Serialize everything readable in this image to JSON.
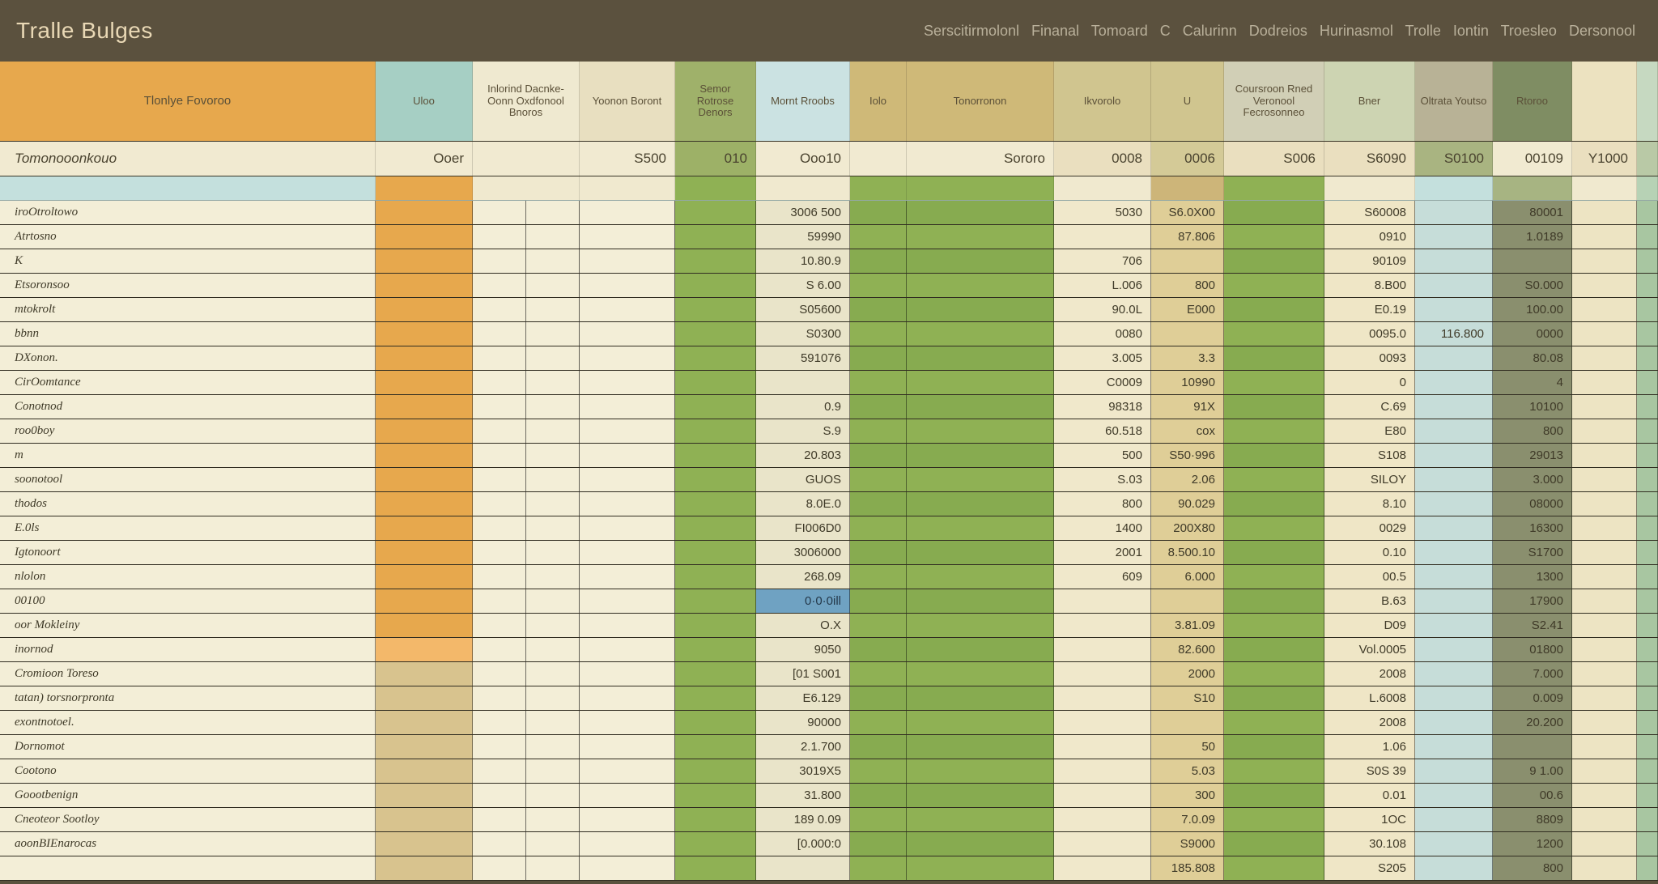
{
  "topbar": {
    "title": "Tralle Bulges",
    "subtitle": "Serscitirmolonl Finanal Tomoard C Calurinn Dodreios Hurinasmol Trolle Iontin Troesleo Dersonool"
  },
  "columns": [
    {
      "label": "Tlonlye Fovoroo"
    },
    {
      "label": "Uloo"
    },
    {
      "label": "Inlorind Dacnke-Oonn Oxdfonool Bnoros"
    },
    {
      "label": "Yoonon Boront"
    },
    {
      "label": "Semor Rotrose Denors"
    },
    {
      "label": "Mornt Rroobs"
    },
    {
      "label": "Iolo"
    },
    {
      "label": "Tonorronon"
    },
    {
      "label": "Ikvorolo"
    },
    {
      "label": "U"
    },
    {
      "label": "Coursroon Rned Veronool Fecrosonneo"
    },
    {
      "label": "Bner"
    },
    {
      "label": "Oltrata Youtso"
    },
    {
      "label": "Rtoroo"
    },
    {
      "label": ""
    },
    {
      "label": ""
    }
  ],
  "totals": {
    "label": "Tomonooonkouo",
    "values": [
      "Ooer",
      "",
      "S500",
      "010",
      "Ooo10",
      "Sororo",
      "",
      "0008",
      "0006",
      "S006",
      "S6090",
      "S0100",
      "00109",
      "Y1000"
    ]
  },
  "rows": [
    {
      "label": "iroOtroltowo",
      "cells": [
        "",
        "",
        "",
        "",
        "3006 500",
        "",
        "",
        "5030",
        "S6.0X00",
        "",
        "S60008",
        "",
        "80001",
        ""
      ]
    },
    {
      "label": "Atrtosno",
      "cells": [
        "",
        "",
        "",
        "",
        "59990",
        "",
        "",
        "",
        "87.806",
        "",
        "0910",
        "",
        "1.0189",
        ""
      ]
    },
    {
      "label": "K",
      "cells": [
        "",
        "",
        "",
        "",
        "10.80.9",
        "",
        "",
        "706",
        "",
        "",
        "90109",
        "",
        "",
        ""
      ]
    },
    {
      "label": "Etsoronsoo",
      "cells": [
        "",
        "",
        "",
        "",
        "S 6.00",
        "",
        "",
        "L.006",
        "800",
        "",
        "8.B00",
        "",
        "S0.000",
        ""
      ]
    },
    {
      "label": "mtokrolt",
      "cells": [
        "",
        "",
        "",
        "",
        "S05600",
        "",
        "",
        "90.0L",
        "E000",
        "",
        "E0.19",
        "",
        "100.00",
        ""
      ]
    },
    {
      "label": "bbnn",
      "cells": [
        "",
        "",
        "",
        "",
        "S0300",
        "",
        "",
        "0080",
        "",
        "",
        "0095.0",
        "116.800",
        "0000",
        ""
      ]
    },
    {
      "label": "DXonon.",
      "cells": [
        "",
        "",
        "",
        "",
        "591076",
        "",
        "",
        "3.005",
        "3.3",
        "",
        "0093",
        "",
        "80.08",
        ""
      ]
    },
    {
      "label": "CirOomtance",
      "cells": [
        "",
        "",
        "",
        "",
        "",
        "",
        "",
        "C0009",
        "10990",
        "",
        "0",
        "",
        "4",
        ""
      ]
    },
    {
      "label": "Conotnod",
      "cells": [
        "",
        "",
        "",
        "",
        "0.9",
        "",
        "",
        "98318",
        "91X",
        "",
        "C.69",
        "",
        "10100",
        ""
      ]
    },
    {
      "label": "roo0boy",
      "cells": [
        "",
        "",
        "",
        "",
        "S.9",
        "",
        "",
        "60.518",
        "cox",
        "",
        "E80",
        "",
        "800",
        ""
      ]
    },
    {
      "label": "m",
      "cells": [
        "",
        "",
        "",
        "",
        "20.803",
        "",
        "",
        "500",
        "S50·996",
        "",
        "S108",
        "",
        "29013",
        ""
      ]
    },
    {
      "label": "soonotool",
      "cells": [
        "",
        "",
        "",
        "",
        "GUOS",
        "",
        "",
        "S.03",
        "2.06",
        "",
        "SILOY",
        "",
        "3.000",
        ""
      ]
    },
    {
      "label": "thodos",
      "cells": [
        "",
        "",
        "",
        "",
        "8.0E.0",
        "",
        "",
        "800",
        "90.029",
        "",
        "8.10",
        "",
        "08000",
        ""
      ]
    },
    {
      "label": "E.0ls",
      "cells": [
        "",
        "",
        "",
        "",
        "FI006D0",
        "",
        "",
        "1400",
        "200X80",
        "",
        "0029",
        "",
        "16300",
        ""
      ]
    },
    {
      "label": "Igtonoort",
      "cells": [
        "",
        "",
        "",
        "",
        "3006000",
        "",
        "",
        "2001",
        "8.500.10",
        "",
        "0.10",
        "",
        "S1700",
        ""
      ]
    },
    {
      "label": "nlolon",
      "cells": [
        "",
        "",
        "",
        "",
        "268.09",
        "",
        "",
        "609",
        "6.000",
        "",
        "00.5",
        "",
        "1300",
        ""
      ]
    },
    {
      "label": "00100",
      "special": "blue",
      "cells": [
        "",
        "",
        "",
        "",
        "0·0·0ill",
        "",
        "",
        "",
        "",
        "",
        "B.63",
        "",
        "17900",
        ""
      ]
    },
    {
      "label": "oor Mokleiny",
      "cells": [
        "",
        "",
        "",
        "",
        "O.X",
        "",
        "",
        "",
        "3.81.09",
        "",
        "D09",
        "",
        "S2.41",
        ""
      ]
    },
    {
      "label": "inornod",
      "variant": "peach",
      "cells": [
        "",
        "",
        "",
        "",
        "9050",
        "",
        "",
        "",
        "82.600",
        "",
        "Vol.0005",
        "",
        "01800",
        ""
      ]
    },
    {
      "label": "Cromioon Toreso",
      "variant": "tan2",
      "cells": [
        "",
        "",
        "",
        "",
        "[01 S001",
        "",
        "",
        "",
        "2000",
        "",
        "2008",
        "",
        "7.000",
        ""
      ]
    },
    {
      "label": "tatan) torsnorpronta",
      "variant": "tan2",
      "cells": [
        "",
        "",
        "",
        "",
        "E6.129",
        "",
        "",
        "",
        "S10",
        "",
        "L.6008",
        "",
        "0.009",
        ""
      ]
    },
    {
      "label": "exontnotoel.",
      "variant": "tan2",
      "cells": [
        "",
        "",
        "",
        "",
        "90000",
        "",
        "",
        "",
        "",
        "",
        "2008",
        "",
        "20.200",
        ""
      ]
    },
    {
      "label": "Dornomot",
      "variant": "tan2",
      "cells": [
        "",
        "",
        "",
        "",
        "2.1.700",
        "",
        "",
        "",
        "50",
        "",
        "1.06",
        "",
        "",
        ""
      ]
    },
    {
      "label": "Cootono",
      "variant": "tan2",
      "cells": [
        "",
        "",
        "",
        "",
        "3019X5",
        "",
        "",
        "",
        "5.03",
        "",
        "S0S 39",
        "",
        "9 1.00",
        ""
      ]
    },
    {
      "label": "Goootbenign",
      "variant": "tan2",
      "cells": [
        "",
        "",
        "",
        "",
        "31.800",
        "",
        "",
        "",
        "300",
        "",
        "0.01",
        "",
        "00.6",
        ""
      ]
    },
    {
      "label": "Cneoteor Sootloy",
      "variant": "tan2",
      "cells": [
        "",
        "",
        "",
        "",
        "189 0.09",
        "",
        "",
        "",
        "7.0.09",
        "",
        "1OC",
        "",
        "8809",
        ""
      ]
    },
    {
      "label": "aoonBIEnarocas",
      "variant": "tan2",
      "cells": [
        "",
        "",
        "",
        "",
        "[0.000:0",
        "",
        "",
        "",
        "S9000",
        "",
        "30.108",
        "",
        "1200",
        ""
      ]
    },
    {
      "label": "",
      "variant": "tan2",
      "cells": [
        "",
        "",
        "",
        "",
        "",
        "",
        "",
        "",
        "185.808",
        "",
        "S205",
        "",
        "800",
        ""
      ]
    }
  ]
}
